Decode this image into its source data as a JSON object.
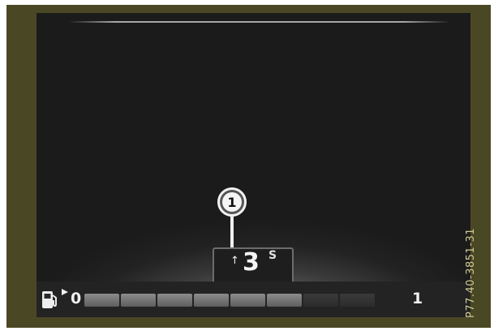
{
  "callout": {
    "label": "1"
  },
  "gear_indicator": {
    "gear": "3",
    "mode": "S",
    "upshift_arrow": "↑"
  },
  "fuel_gauge": {
    "min_label": "0",
    "max_label": "1",
    "segments_total": 8,
    "segments_lit": 6,
    "icon": "fuel-pump-icon"
  },
  "figure_code": "P77.40-3851-31",
  "colors": {
    "frame": "#4a4724",
    "display_bg": "#1b1b1b",
    "segment_on": "#8c8c8c",
    "segment_off": "#333333",
    "text": "#f0f0f0"
  }
}
